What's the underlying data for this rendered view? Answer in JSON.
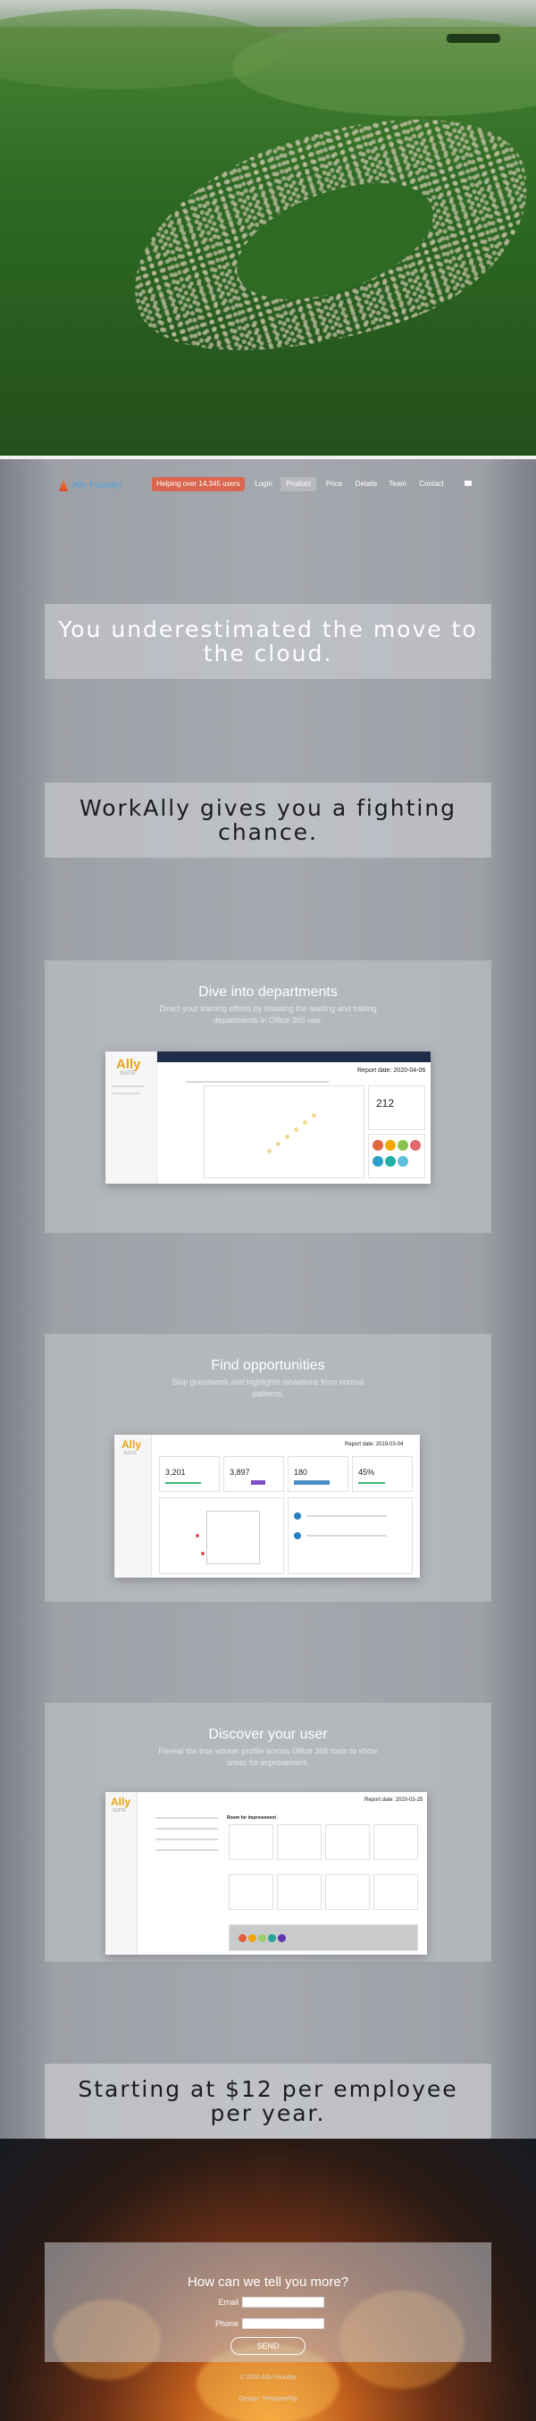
{
  "nav": {
    "logo": "Ally Foundry",
    "cta": "Helping over 14,345 users",
    "items": [
      "Login",
      "Product",
      "Price",
      "Details",
      "Team",
      "Contact"
    ],
    "active": "Product"
  },
  "headlines": {
    "h1": "You underestimated the move to the cloud.",
    "h2": "WorkAlly gives you a fighting chance.",
    "h3": "Starting at $12 per employee per year."
  },
  "features": [
    {
      "title": "Dive into departments",
      "text": "Direct your training efforts by showing the leading and trailing departments in Office 365 use.",
      "shot": {
        "brand": "Ally",
        "sub": "SUITE",
        "report": "Report date: 2020-04-06",
        "metric": "212"
      }
    },
    {
      "title": "Find opportunities",
      "text": "Skip guesswork and highlights deviations from normal patterns.",
      "shot": {
        "brand": "Ally",
        "sub": "SUITE",
        "report": "Report date: 2019-03-04",
        "stats": [
          "3,201",
          "3,897",
          "180",
          "45%"
        ]
      }
    },
    {
      "title": "Discover your user",
      "text": "Reveal the true worker profile across Office 365 tools to show areas for improvement.",
      "shot": {
        "brand": "Ally",
        "sub": "SUITE",
        "report": "Report date: 2020-03-25",
        "section": "Room for improvement"
      }
    }
  ],
  "contact": {
    "title": "How can we tell you more?",
    "email_label": "Email",
    "phone_label": "Phone",
    "send": "SEND"
  },
  "footer": {
    "copyright": "© 2020 Ally Foundry",
    "design": "Design: TemplateFlip"
  },
  "colors": {
    "cta": "#d9664e",
    "brand": "#e8a317",
    "logo": "#4aa3df"
  }
}
